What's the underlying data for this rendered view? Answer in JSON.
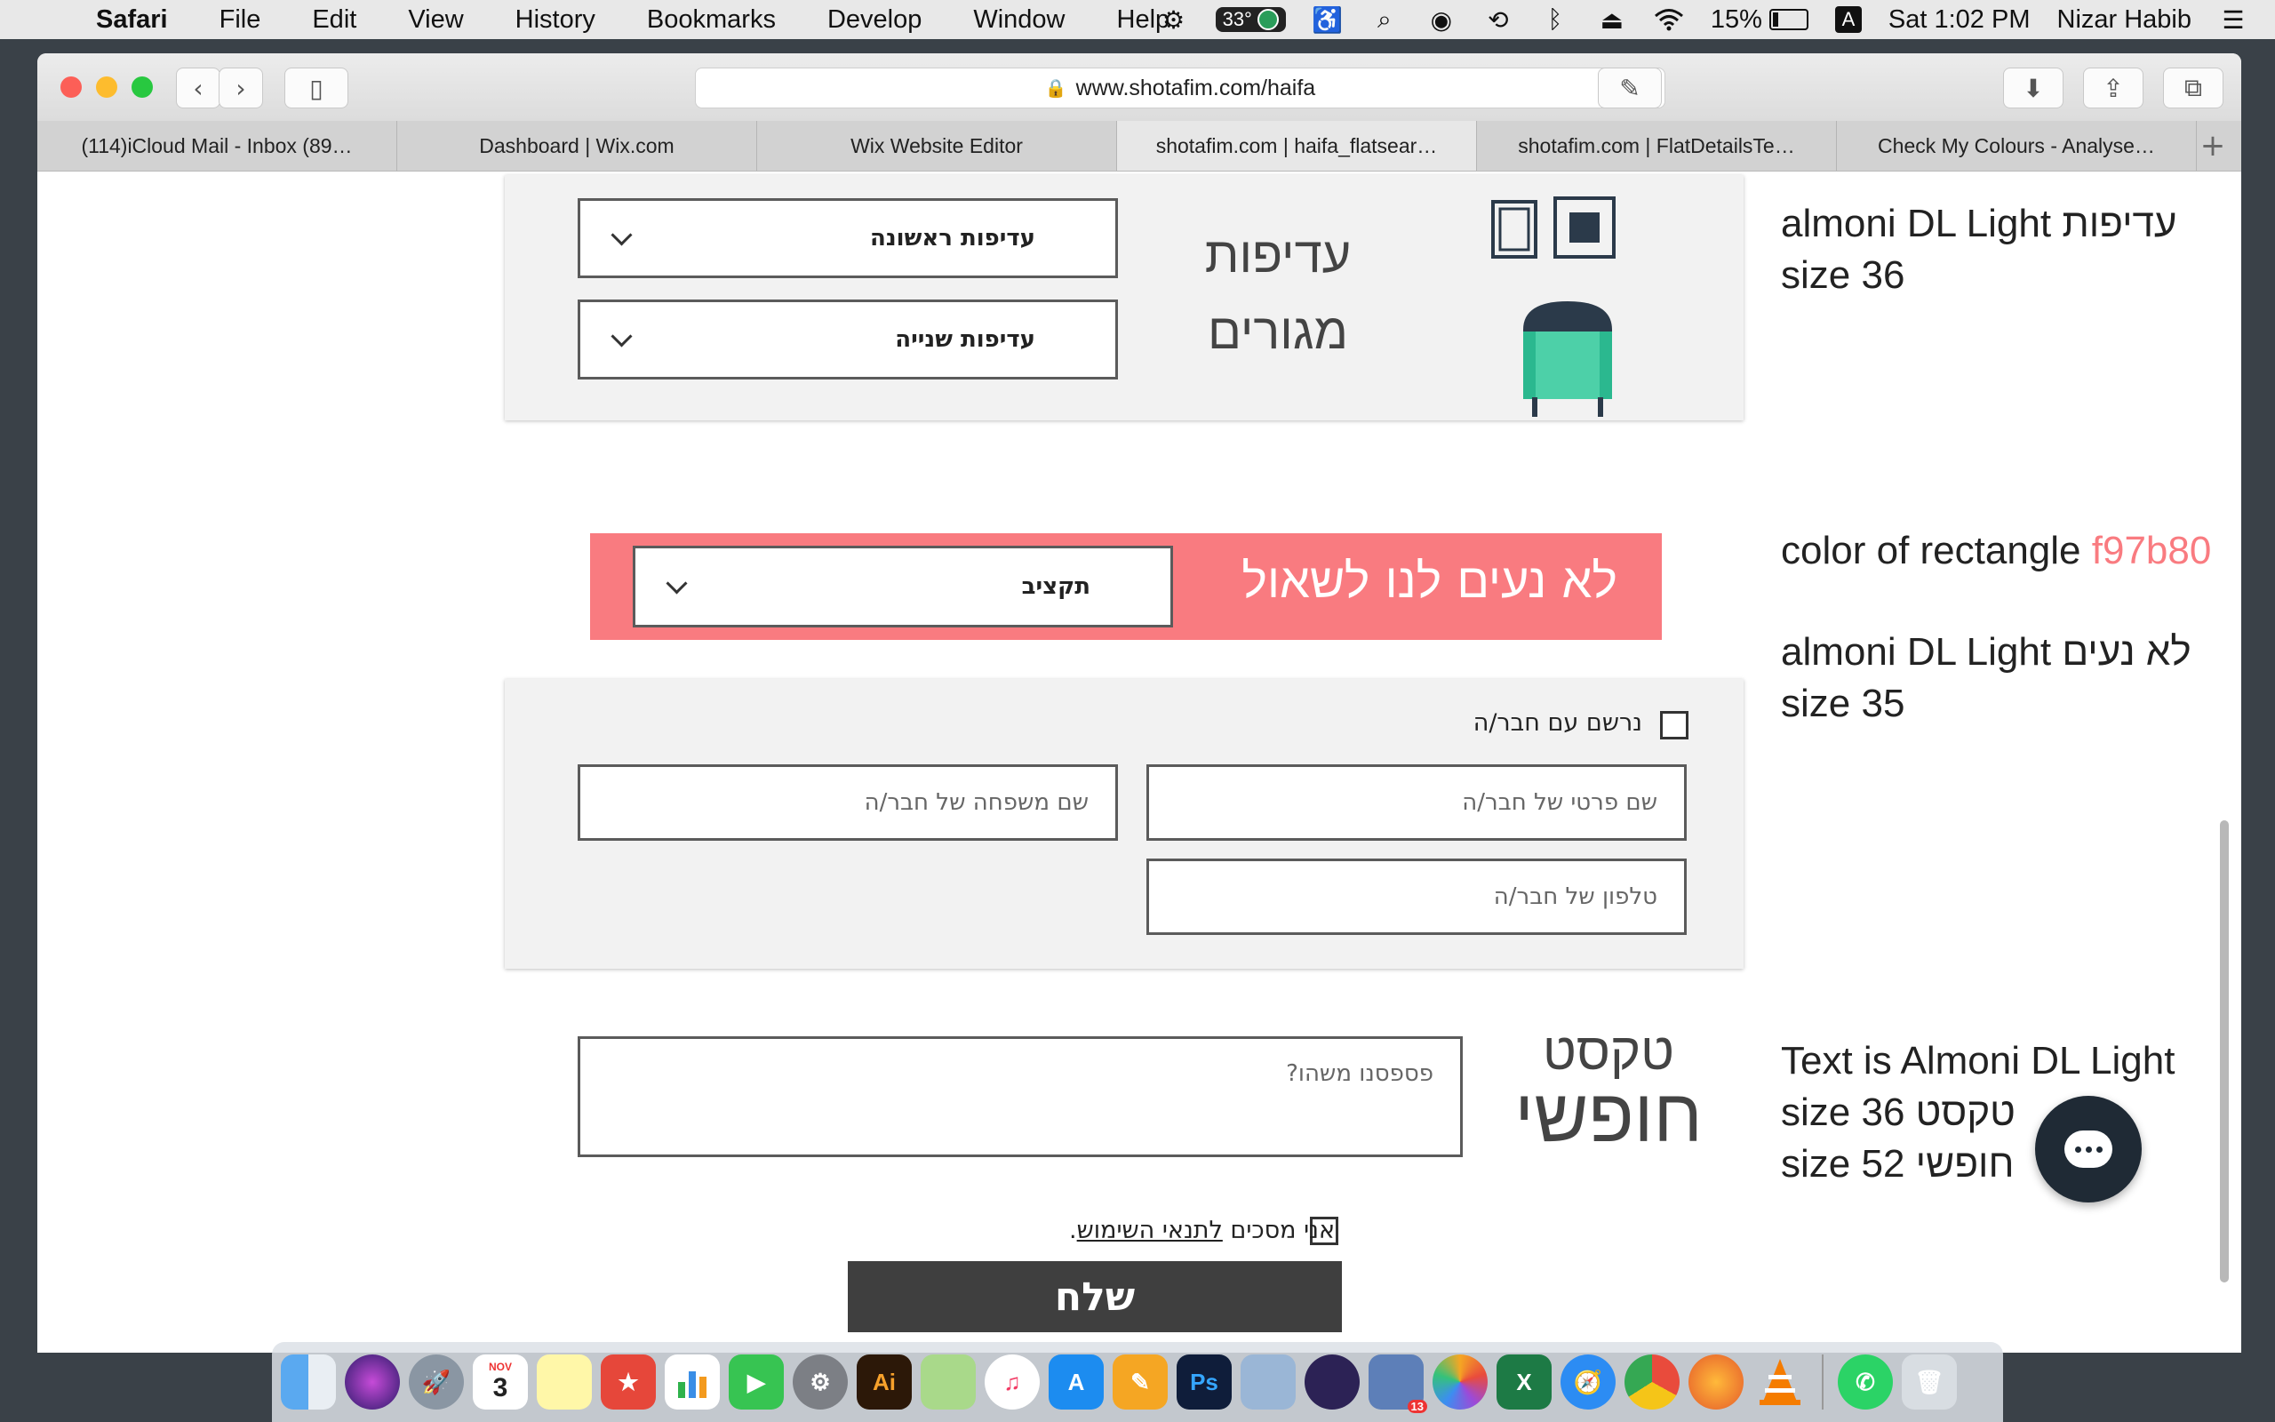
{
  "menubar": {
    "app": "Safari",
    "items": [
      "File",
      "Edit",
      "View",
      "History",
      "Bookmarks",
      "Develop",
      "Window",
      "Help"
    ],
    "temperature": "33°",
    "battery": "15%",
    "input_source": "A",
    "clock": "Sat 1:02 PM",
    "user": "Nizar Habib"
  },
  "browser": {
    "url": "www.shotafim.com/haifa",
    "tabs": [
      {
        "title": "(114)iCloud Mail - Inbox (89…",
        "active": false
      },
      {
        "title": "Dashboard | Wix.com",
        "active": false
      },
      {
        "title": "Wix Website Editor",
        "active": false
      },
      {
        "title": "shotafim.com | haifa_flatsear…",
        "active": true
      },
      {
        "title": "shotafim.com | FlatDetailsTe…",
        "active": false
      },
      {
        "title": "Check My Colours - Analyse…",
        "active": false
      }
    ]
  },
  "form": {
    "preferences": {
      "title_line1": "עדיפות",
      "title_line2": "מגורים",
      "select1": "עדיפות ראשונה",
      "select2": "עדיפות שנייה"
    },
    "budget": {
      "title": "לא נעים לנו לשאול",
      "select": "תקציב",
      "color": "#f97b80"
    },
    "partner": {
      "checkbox_label": "נרשם עם חבר/ה",
      "first_name_placeholder": "שם פרטי של חבר/ה",
      "last_name_placeholder": "שם משפחה של חבר/ה",
      "phone_placeholder": "טלפון של חבר/ה"
    },
    "free_text": {
      "title_line1": "טקסט",
      "title_line2": "חופשי",
      "placeholder": "פספסנו משהו?"
    },
    "terms": {
      "prefix": "אני מסכים ",
      "link": "לתנאי השימוש",
      "suffix": "."
    },
    "submit": "שלח"
  },
  "annotations": {
    "a1_line1": "almoni DL Light  עדיפות",
    "a1_line2": "size 36",
    "a2_prefix": "color of rectangle ",
    "a2_hex": "f97b80",
    "a3_line1": "almoni DL Light  לא נעים",
    "a3_line2": "size 35",
    "a4_line1": "Text is  Almoni DL Light",
    "a4_line2": "size 36 טקסט",
    "a4_line3": "size 52 חופשי"
  },
  "dock": {
    "calendar_month": "NOV",
    "calendar_day": "3",
    "badge_count": "13",
    "apps": [
      "Finder",
      "Siri",
      "Launchpad",
      "Calendar",
      "Notes",
      "Wunderlist",
      "Numbers",
      "FaceTime",
      "System Preferences",
      "Illustrator",
      "Maps",
      "iTunes",
      "App Store",
      "Pages",
      "Photoshop",
      "Preview",
      "Eclipse",
      "Launchpad Grid",
      "Photos",
      "Excel",
      "Safari",
      "Chrome",
      "Firefox",
      "VLC",
      "WhatsApp",
      "Trash"
    ]
  }
}
